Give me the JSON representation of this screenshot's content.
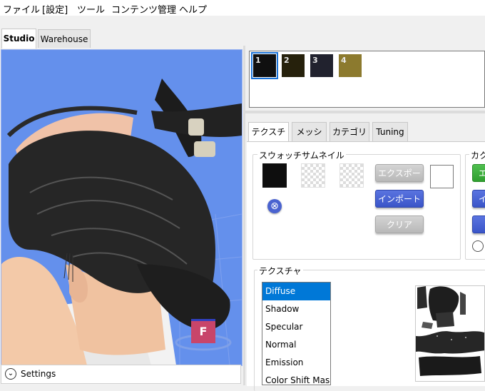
{
  "menu": [
    "ファイル",
    "[設定]",
    "ツール",
    "コンテンツ管理",
    "ヘルプ"
  ],
  "left_tabs": [
    {
      "label": "Studio",
      "active": true
    },
    {
      "label": "Warehouse",
      "active": false
    }
  ],
  "viewport": {
    "badge_letter": "F",
    "settings_label": "Settings"
  },
  "swatches": [
    {
      "number": "1",
      "color": "#101010",
      "selected": true
    },
    {
      "number": "2",
      "color": "#26210c",
      "selected": false
    },
    {
      "number": "3",
      "color": "#21222e",
      "selected": false
    },
    {
      "number": "4",
      "color": "#8c7a2e",
      "selected": false
    }
  ],
  "right_tabs": [
    {
      "label": "テクスチャ",
      "active": true
    },
    {
      "label": "メッシュ",
      "active": false
    },
    {
      "label": "カテゴリー",
      "active": false
    },
    {
      "label": "Tuning",
      "active": false
    }
  ],
  "swatch_thumbnail_group": {
    "title": "スウォッチサムネイル",
    "export_label": "エクスポート",
    "import_label": "インポート",
    "clear_label": "クリア"
  },
  "category_group": {
    "title_visible": "カク",
    "button_visible": "エ",
    "button2_visible": "イ"
  },
  "texture_group": {
    "title": "テクスチャ",
    "items": [
      "Diffuse",
      "Shadow",
      "Specular",
      "Normal",
      "Emission",
      "Color Shift Mask"
    ],
    "selected": "Diffuse"
  },
  "colors": {
    "viewport_bg": "#6490ec",
    "accent_blue": "#0078d7",
    "button_blue": "#4a63d0",
    "button_green": "#3aae3a"
  }
}
